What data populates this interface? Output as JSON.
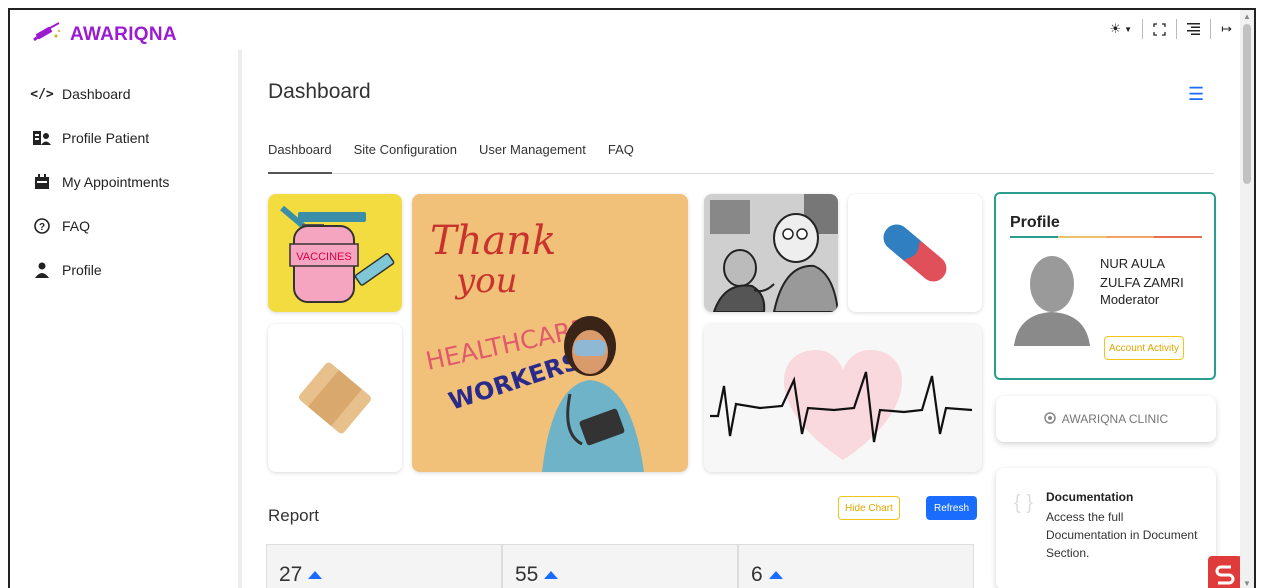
{
  "brand": {
    "name": "AWARIQNA"
  },
  "sidebar": {
    "items": [
      {
        "label": "Dashboard",
        "icon": "code-icon"
      },
      {
        "label": "Profile Patient",
        "icon": "id-card-icon"
      },
      {
        "label": "My Appointments",
        "icon": "calendar-icon"
      },
      {
        "label": "FAQ",
        "icon": "question-circle-icon"
      },
      {
        "label": "Profile",
        "icon": "user-icon"
      }
    ]
  },
  "topbar": {
    "icons": [
      "sun-icon",
      "fullscreen-icon",
      "menu-lines-icon",
      "logout-icon"
    ]
  },
  "main": {
    "title": "Dashboard",
    "tabs": [
      {
        "label": "Dashboard",
        "active": true
      },
      {
        "label": "Site Configuration",
        "active": false
      },
      {
        "label": "User Management",
        "active": false
      },
      {
        "label": "FAQ",
        "active": false
      }
    ],
    "gallery": {
      "vaccine_label": "VACCINES",
      "poster_lines": [
        "Thank",
        "you",
        "HEALTHCARE",
        "WORKERS"
      ]
    },
    "report": {
      "title": "Report",
      "hide_chart_label": "Hide Chart",
      "refresh_label": "Refresh",
      "stats": [
        {
          "value": "27"
        },
        {
          "value": "55"
        },
        {
          "value": "6"
        }
      ]
    }
  },
  "profile": {
    "title": "Profile",
    "name": "NUR AULA ZULFA ZAMRI",
    "role": "Moderator",
    "activity_label": "Account Activity"
  },
  "clinic": {
    "label": "AWARIQNA CLINIC"
  },
  "docs": {
    "title": "Documentation",
    "text": "Access the full Documentation in Document Section."
  },
  "colors": {
    "brand": "#9b1bd1",
    "primary": "#1a6cff",
    "warning": "#f0c419",
    "teal": "#2a9d8f"
  }
}
